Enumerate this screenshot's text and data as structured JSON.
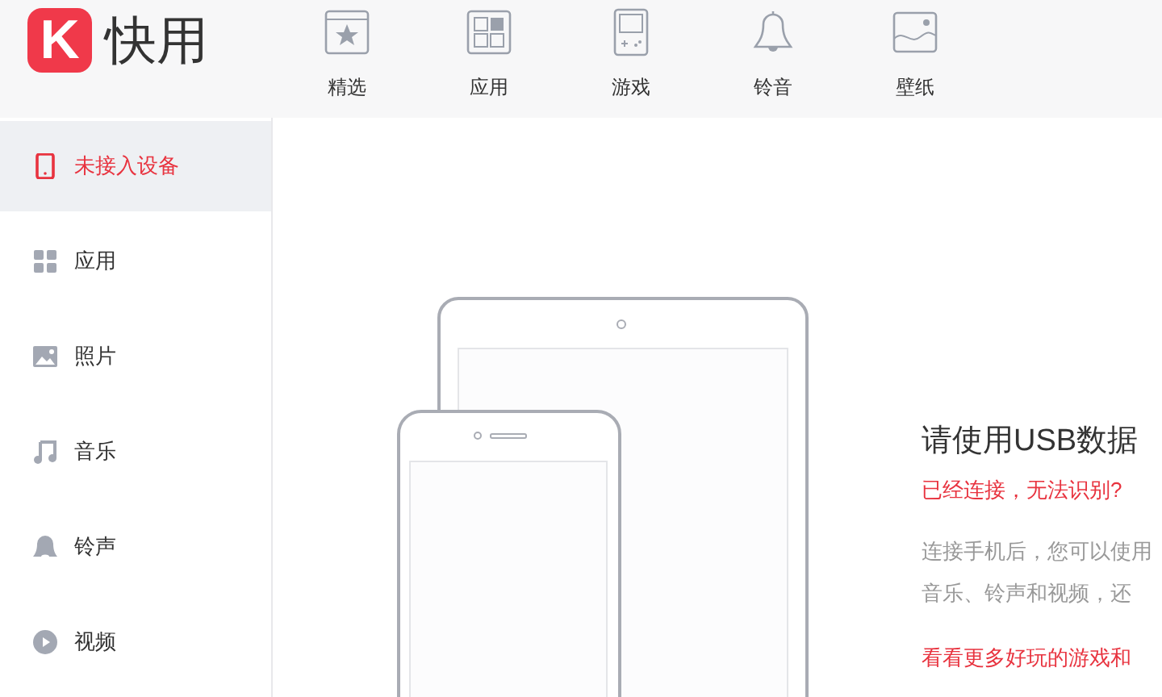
{
  "app": {
    "logo_letter": "K",
    "name": "快用"
  },
  "nav": [
    {
      "label": "精选",
      "selected": false
    },
    {
      "label": "应用",
      "selected": false
    },
    {
      "label": "游戏",
      "selected": false
    },
    {
      "label": "铃音",
      "selected": false
    },
    {
      "label": "壁纸",
      "selected": false
    }
  ],
  "sidebar": {
    "items": [
      {
        "label": "未接入设备",
        "selected": true
      },
      {
        "label": "应用",
        "selected": false
      },
      {
        "label": "照片",
        "selected": false
      },
      {
        "label": "音乐",
        "selected": false
      },
      {
        "label": "铃声",
        "selected": false
      },
      {
        "label": "视频",
        "selected": false
      }
    ]
  },
  "main": {
    "title": "请使用USB数据",
    "error_link": "已经连接，无法识别?",
    "description": [
      "连接手机后，您可以使用",
      "音乐、铃声和视频，还"
    ],
    "more_link": "看看更多好玩的游戏和"
  }
}
